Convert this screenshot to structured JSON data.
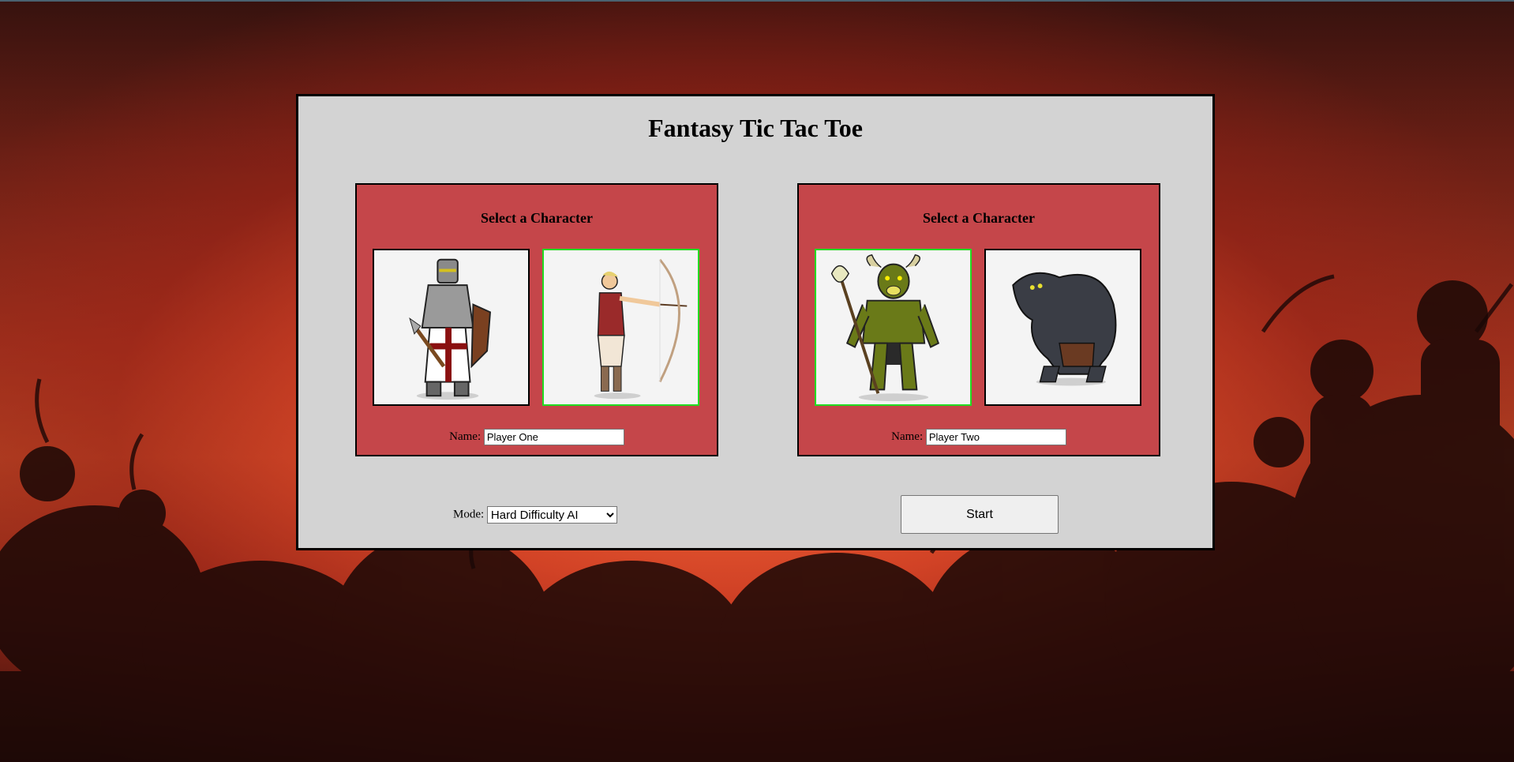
{
  "app": {
    "title": "Fantasy Tic Tac Toe"
  },
  "players": [
    {
      "heading": "Select a Character",
      "characters": [
        {
          "name": "knight",
          "icon": "knight-icon",
          "selected": false
        },
        {
          "name": "archer",
          "icon": "archer-icon",
          "selected": true
        }
      ],
      "name_label": "Name:",
      "name_value": "Player One"
    },
    {
      "heading": "Select a Character",
      "characters": [
        {
          "name": "minotaur",
          "icon": "minotaur-icon",
          "selected": true
        },
        {
          "name": "troll",
          "icon": "troll-icon",
          "selected": false
        }
      ],
      "name_label": "Name:",
      "name_value": "Player Two"
    }
  ],
  "mode": {
    "label": "Mode:",
    "selected": "Hard Difficulty AI"
  },
  "start": {
    "label": "Start"
  },
  "colors": {
    "panel": "#d3d3d3",
    "card": "#c5464a",
    "selected_border": "#22dd22"
  }
}
